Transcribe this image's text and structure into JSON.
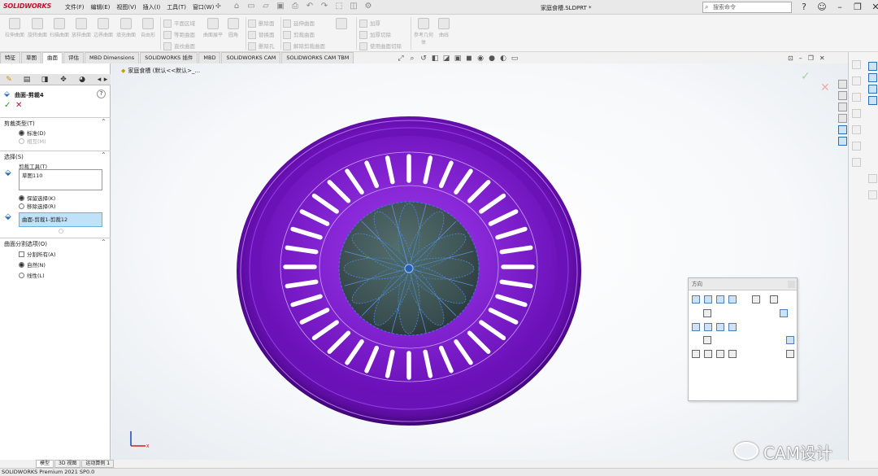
{
  "app": {
    "logo": "SOLIDWORKS",
    "menus": [
      "文件(F)",
      "编辑(E)",
      "视图(V)",
      "插入(I)",
      "工具(T)",
      "窗口(W)"
    ],
    "doc_title": "家庭食槽.SLDPRT *",
    "search_placeholder": "搜索命令"
  },
  "ribbon": {
    "large_buttons": [
      "拉伸曲面",
      "旋转曲面",
      "扫描曲面",
      "放样曲面",
      "边界曲面",
      "填充曲面",
      "自由形"
    ],
    "small_buttons": [
      "平面区域",
      "等距曲面",
      "直纹曲面",
      "删除面",
      "替换面",
      "删除孔",
      "延伸曲面",
      "剪裁曲面",
      "解除剪裁曲面",
      "加厚",
      "加厚切除",
      "使用曲面切除"
    ],
    "more_buttons": [
      "曲面展平",
      "圆角",
      "参考几何体",
      "曲线"
    ]
  },
  "tabs": [
    "特征",
    "草图",
    "曲面",
    "评估",
    "MBD Dimensions",
    "SOLIDWORKS 插件",
    "MBD",
    "SOLIDWORKS CAM",
    "SOLIDWORKS CAM TBM"
  ],
  "active_tab": "曲面",
  "property_manager": {
    "title": "曲面-剪裁4",
    "trim_type": {
      "header": "剪裁类型(T)",
      "options": [
        "标准(D)",
        "相互(M)"
      ]
    },
    "selections": {
      "header": "选择(S)",
      "trim_tool_label": "剪裁工具(T)",
      "trim_tool_value": "草图110",
      "keep_options": [
        "保留选择(K)",
        "移除选择(R)"
      ],
      "keep_value": "曲面-剪裁1-剪裁12"
    },
    "split_options": {
      "header": "曲面分割选项(O)",
      "split_all": "分割所有(A)",
      "natural": "自然(N)",
      "linear": "线性(L)"
    }
  },
  "viewport": {
    "tree_label": "家庭食槽 (默认<<默认>_...",
    "orientation_title": "方向",
    "part_color": "#7a18c4",
    "slot_count": 36
  },
  "bottom_tabs": [
    "模型",
    "3D 视图",
    "运动算例 1"
  ],
  "status": "SOLIDWORKS Premium 2021 SP0.0",
  "watermark": "CAM设计"
}
